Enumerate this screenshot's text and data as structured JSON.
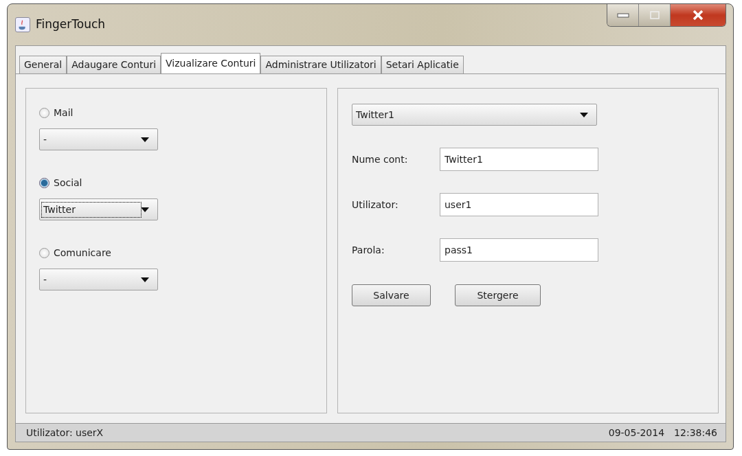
{
  "window": {
    "title": "FingerTouch"
  },
  "tabs": [
    {
      "label": "General",
      "selected": false
    },
    {
      "label": "Adaugare Conturi",
      "selected": false
    },
    {
      "label": "Vizualizare Conturi",
      "selected": true
    },
    {
      "label": "Administrare Utilizatori",
      "selected": false
    },
    {
      "label": "Setari Aplicatie",
      "selected": false
    }
  ],
  "categories": [
    {
      "label": "Mail",
      "selected": false,
      "combo": {
        "value": "-",
        "focused": false
      }
    },
    {
      "label": "Social",
      "selected": true,
      "combo": {
        "value": "Twitter",
        "focused": true
      }
    },
    {
      "label": "Comunicare",
      "selected": false,
      "combo": {
        "value": "-",
        "focused": false
      }
    }
  ],
  "account_select": {
    "value": "Twitter1"
  },
  "fields": [
    {
      "label": "Nume cont:",
      "value": "Twitter1"
    },
    {
      "label": "Utilizator:",
      "value": "user1"
    },
    {
      "label": "Parola:",
      "value": "pass1"
    }
  ],
  "buttons": [
    "Salvare",
    "Stergere"
  ],
  "status_bar": {
    "user": "Utilizator: userX",
    "date": "09-05-2014",
    "time": "12:38:46"
  }
}
